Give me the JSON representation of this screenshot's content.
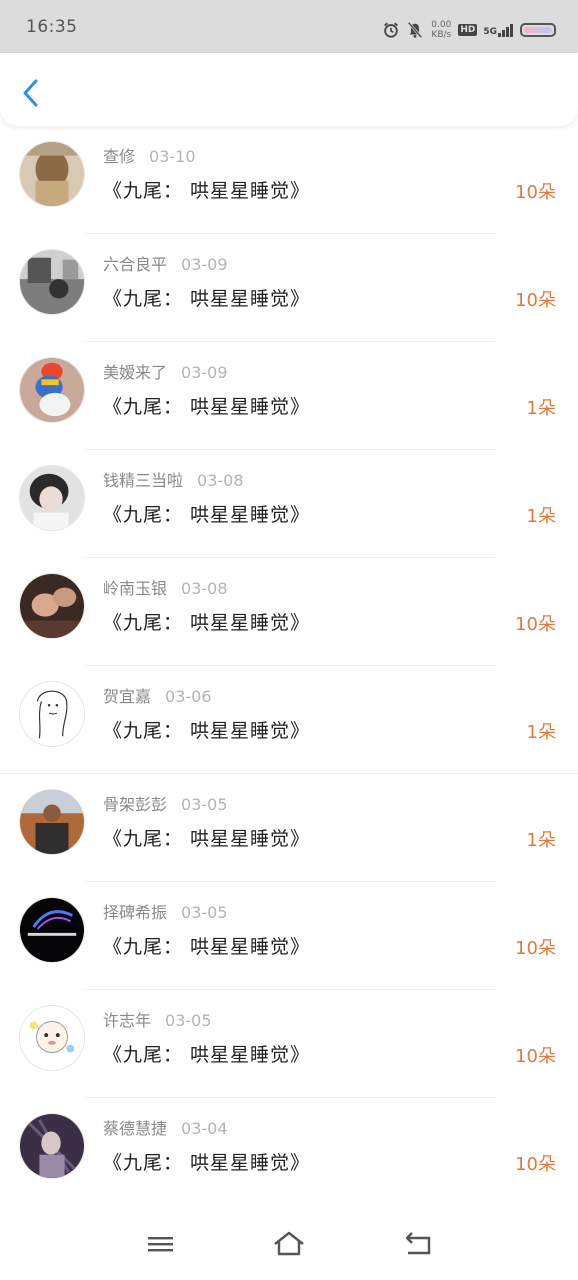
{
  "status_bar": {
    "time": "16:35",
    "speed_top": "0.00",
    "speed_bottom": "KB/s",
    "hd": "HD",
    "network": "5G",
    "icons": [
      "alarm-icon",
      "mute-bell-icon",
      "signal-icon",
      "battery-icon"
    ]
  },
  "header": {
    "back_icon": "chevron-left-icon",
    "accent": "#2f8fe0"
  },
  "rows": [
    {
      "name": "查修",
      "date": "03-10",
      "title": "《九尾： 哄星星睡觉》",
      "amount": "10朵"
    },
    {
      "name": "六合良平",
      "date": "03-09",
      "title": "《九尾： 哄星星睡觉》",
      "amount": "10朵"
    },
    {
      "name": "美嫒来了",
      "date": "03-09",
      "title": "《九尾： 哄星星睡觉》",
      "amount": "1朵"
    },
    {
      "name": "钱精三当啦",
      "date": "03-08",
      "title": "《九尾： 哄星星睡觉》",
      "amount": "1朵"
    },
    {
      "name": "岭南玉银",
      "date": "03-08",
      "title": "《九尾： 哄星星睡觉》",
      "amount": "10朵"
    },
    {
      "name": "贺宜嘉",
      "date": "03-06",
      "title": "《九尾： 哄星星睡觉》",
      "amount": "1朵"
    },
    {
      "name": "骨架彭彭",
      "date": "03-05",
      "title": "《九尾： 哄星星睡觉》",
      "amount": "1朵"
    },
    {
      "name": "择碑希振",
      "date": "03-05",
      "title": "《九尾： 哄星星睡觉》",
      "amount": "10朵"
    },
    {
      "name": "许志年",
      "date": "03-05",
      "title": "《九尾： 哄星星睡觉》",
      "amount": "10朵"
    },
    {
      "name": "蔡德慧捷",
      "date": "03-04",
      "title": "《九尾： 哄星星睡觉》",
      "amount": "10朵"
    }
  ],
  "colors": {
    "amount": "#e07a3c",
    "name": "#8a8a8a",
    "date": "#b5b5b5",
    "title": "#222222"
  },
  "navbar": {
    "icons": [
      "menu-icon",
      "home-icon",
      "back-icon"
    ]
  }
}
